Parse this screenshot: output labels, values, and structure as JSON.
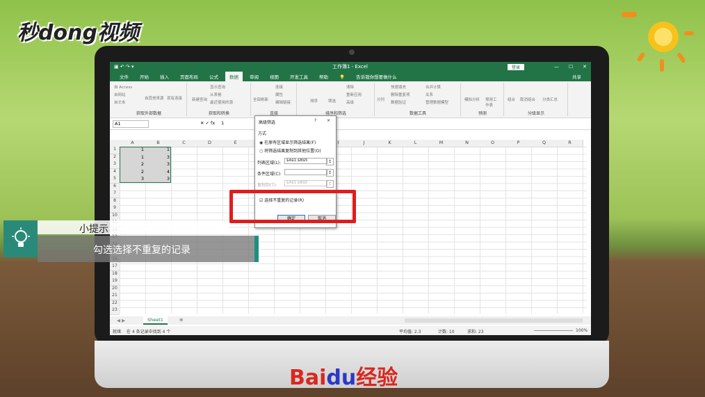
{
  "brand": {
    "top_logo": "秒dong视频",
    "bottom_logo_pre": "Bai",
    "bottom_logo_paw": "du",
    "bottom_logo_post": "经验"
  },
  "excel": {
    "title": "工作簿1 - Excel",
    "login": "登录",
    "tabs": [
      "文件",
      "开始",
      "插入",
      "页面布局",
      "公式",
      "数据",
      "审阅",
      "视图",
      "开发工具",
      "帮助"
    ],
    "active_tab": "数据",
    "tell_me": "告诉我你想要做什么",
    "share": "共享",
    "ribbon_groups": [
      {
        "label": "获取外部数据",
        "buttons": [
          "自 Access",
          "自网站",
          "自文本",
          "自其他来源",
          "现有连接"
        ]
      },
      {
        "label": "获取和转换",
        "buttons": [
          "新建查询",
          "显示查询",
          "从表格",
          "最近使用的源"
        ]
      },
      {
        "label": "连接",
        "buttons": [
          "全部刷新",
          "连接",
          "属性",
          "编辑链接"
        ]
      },
      {
        "label": "排序和筛选",
        "buttons": [
          "排序",
          "筛选",
          "清除",
          "重新应用",
          "高级"
        ]
      },
      {
        "label": "数据工具",
        "buttons": [
          "分列",
          "快速填充",
          "删除重复项",
          "数据验证",
          "合并计算",
          "关系",
          "管理数据模型"
        ]
      },
      {
        "label": "预测",
        "buttons": [
          "模拟分析",
          "预测工作表"
        ]
      },
      {
        "label": "分级显示",
        "buttons": [
          "组合",
          "取消组合",
          "分类汇总"
        ]
      }
    ],
    "name_box": "A1",
    "formula_value": "1",
    "columns": [
      "A",
      "B",
      "C",
      "D",
      "E",
      "F",
      "G",
      "H",
      "I",
      "J",
      "K",
      "L",
      "M",
      "N",
      "O",
      "P",
      "Q",
      "R"
    ],
    "rows": [
      "1",
      "2",
      "3",
      "4",
      "5",
      "6",
      "7",
      "8",
      "9",
      "10",
      "11",
      "12",
      "13",
      "14",
      "15",
      "16",
      "17",
      "18",
      "19",
      "20",
      "21",
      "22",
      "23"
    ],
    "cells": [
      [
        "1",
        "1"
      ],
      [
        "1",
        "3"
      ],
      [
        "2",
        "3"
      ],
      [
        "2",
        "4"
      ],
      [
        "3",
        "3"
      ]
    ],
    "sheet_tab": "Sheet1",
    "status_left": "就绪",
    "status_msg": "在 4 条记录中找到 4 个",
    "status_avg": "平均值: 2.3",
    "status_count": "计数: 10",
    "status_sum": "求和: 23",
    "zoom": "100%"
  },
  "dialog": {
    "title": "高级筛选",
    "help": "?",
    "close": "×",
    "method_label": "方式",
    "radio1": "在原有区域显示筛选结果(F)",
    "radio2": "将筛选结果复制到其他位置(O)",
    "list_range_label": "列表区域(L):",
    "list_range_value": "$A$1:$B$5",
    "criteria_label": "条件区域(C):",
    "copy_to_label": "复制到(T):",
    "copy_to_value": "$A$1:$B$5",
    "unique_checkbox": "选择不重复的记录(R)",
    "ok": "确定",
    "cancel": "取消"
  },
  "tip": {
    "title": "小提示",
    "text": "勾选选择不重复的记录"
  }
}
